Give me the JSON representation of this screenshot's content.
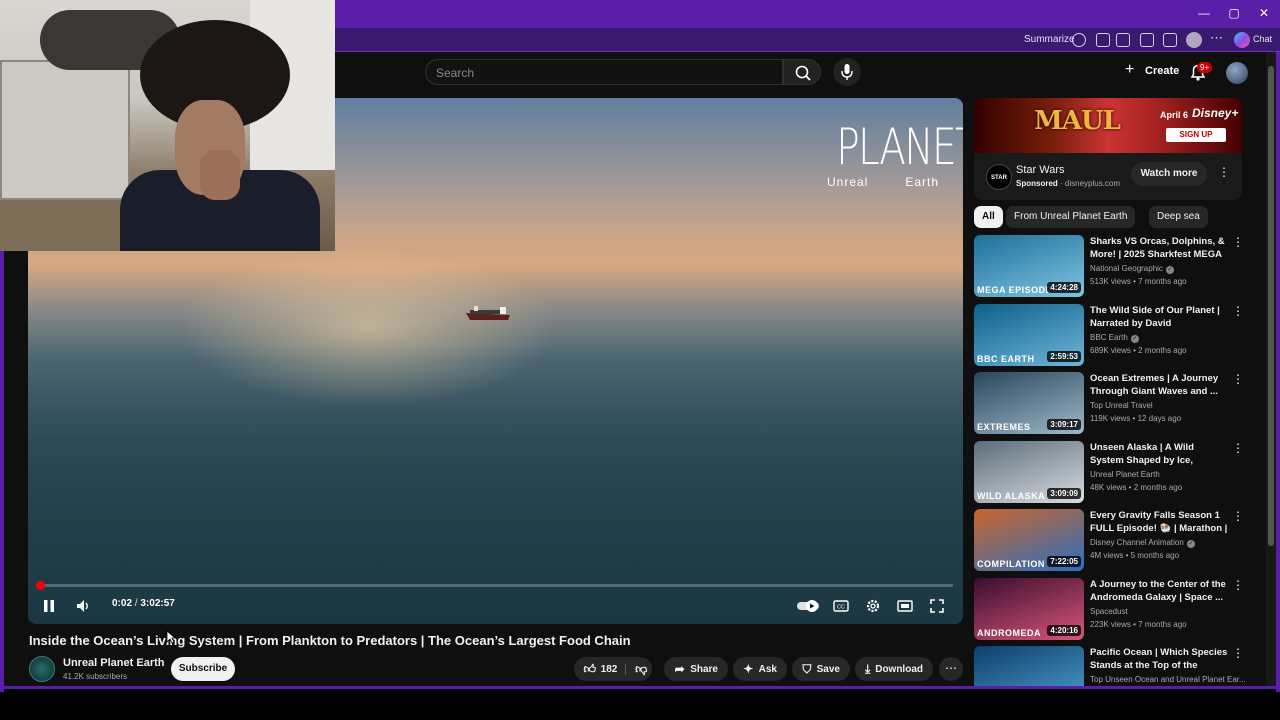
{
  "browser": {
    "window_controls": [
      "—",
      "▢",
      "✕"
    ],
    "toolbar": {
      "summarize_label": "Summarize",
      "chat_label": "Chat"
    }
  },
  "header": {
    "search_placeholder": "Search",
    "create_label": "Create",
    "notification_badge": "9+"
  },
  "player": {
    "logo_title": "PLANET",
    "logo_sub_left": "Unreal",
    "logo_sub_right": "Earth",
    "current_time": "0:02",
    "separator": " / ",
    "duration": "3:02:57",
    "progress_fraction": 0.0002
  },
  "video": {
    "title": "Inside the Ocean’s Living System | From Plankton to Predators | The Ocean’s Largest Food Chain",
    "channel_name": "Unreal Planet Earth",
    "subscribers": "41.2K subscribers",
    "subscribe_label": "Subscribe",
    "likes": "182",
    "share_label": "Share",
    "ask_label": "Ask",
    "save_label": "Save",
    "download_label": "Download"
  },
  "ad": {
    "banner_title": "MAUL",
    "banner_date": "April 6",
    "banner_brand": "Disney+",
    "banner_cta": "SIGN UP",
    "logo_text": "STAR WARS",
    "title": "Star Wars",
    "sponsored": "Sponsored",
    "domain": "disneyplus.com",
    "cta": "Watch more"
  },
  "chips": [
    "All",
    "From Unreal Planet Earth",
    "Deep sea"
  ],
  "recommendations": [
    {
      "title": "Sharks VS Orcas, Dolphins, & More! | 2025 Sharkfest MEGA ...",
      "channel": "National Geographic",
      "verified": true,
      "meta": "513K views • 7 months ago",
      "duration": "4:24:28",
      "thumb_label": "MEGA EPISODE",
      "thumb_colors": [
        "#1d6f9a",
        "#7fc4e0"
      ]
    },
    {
      "title": "The Wild Side of Our Planet | Narrated by David Attenborou...",
      "channel": "BBC Earth",
      "verified": true,
      "meta": "689K views • 2 months ago",
      "duration": "2:59:53",
      "thumb_label": "BBC EARTH",
      "thumb_colors": [
        "#0e5f8c",
        "#6fb6d8"
      ]
    },
    {
      "title": "Ocean Extremes | A Journey Through Giant Waves and ...",
      "channel": "Top Unreal Travel",
      "verified": false,
      "meta": "119K views • 12 days ago",
      "duration": "3:09:17",
      "thumb_label": "EXTREMES",
      "thumb_colors": [
        "#28475c",
        "#9fb8c8"
      ]
    },
    {
      "title": "Unseen Alaska | A Wild System Shaped by Ice, Distance, and ...",
      "channel": "Unreal Planet Earth",
      "verified": false,
      "meta": "48K views • 2 months ago",
      "duration": "3:09:09",
      "thumb_label": "WILD ALASKA",
      "thumb_colors": [
        "#5c6c78",
        "#d8dde2"
      ]
    },
    {
      "title": "Every Gravity Falls Season 1 FULL Episode! 🐏 | Marathon | ...",
      "channel": "Disney Channel Animation",
      "verified": true,
      "meta": "4M views • 5 months ago",
      "duration": "7:22:05",
      "thumb_label": "COMPILATION",
      "thumb_colors": [
        "#c9652a",
        "#2b6fc0"
      ]
    },
    {
      "title": "A Journey to the Center of the Andromeda Galaxy | Space ...",
      "channel": "Spacedust",
      "verified": false,
      "meta": "223K views • 7 months ago",
      "duration": "4:20:16",
      "thumb_label": "ANDROMEDA",
      "thumb_colors": [
        "#3a0d2e",
        "#d8567a"
      ]
    },
    {
      "title": "Pacific Ocean | Which Species Stands at the Top of the Pacifi...",
      "channel": "Top Unseen Ocean and Unreal Planet Ear...",
      "verified": false,
      "meta": "",
      "duration": "",
      "thumb_label": "",
      "thumb_colors": [
        "#0d3e6a",
        "#4fa0d0"
      ]
    }
  ]
}
